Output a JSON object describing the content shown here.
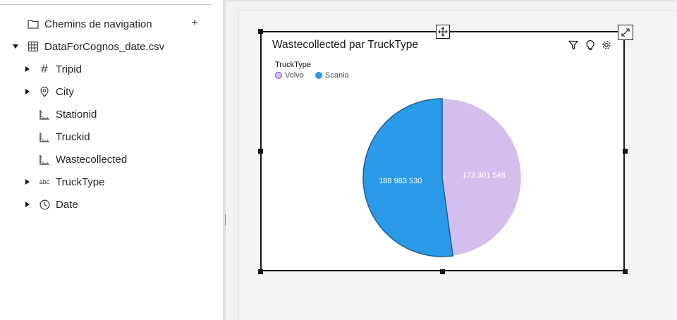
{
  "tree": {
    "paths_label": "Chemins de navigation",
    "add_symbol": "+",
    "source_name": "DataForCognos_date.csv",
    "fields": [
      {
        "label": "Tripid",
        "icon": "hash-icon",
        "expandable": true
      },
      {
        "label": "City",
        "icon": "location-pin-icon",
        "expandable": true
      },
      {
        "label": "Stationid",
        "icon": "measure-ruler-icon",
        "expandable": false
      },
      {
        "label": "Truckid",
        "icon": "measure-ruler-icon",
        "expandable": false
      },
      {
        "label": "Wastecollected",
        "icon": "measure-ruler-icon",
        "expandable": false
      },
      {
        "label": "TruckType",
        "icon": "abc-text-icon",
        "expandable": true
      },
      {
        "label": "Date",
        "icon": "clock-icon",
        "expandable": true
      }
    ],
    "abc_icon_text": "abc"
  },
  "widget": {
    "title": "Wastecollected par TruckType",
    "legend_title": "TruckType"
  },
  "chart_data": {
    "type": "pie",
    "title": "Wastecollected par TruckType",
    "legend_title": "TruckType",
    "legend_position": "top-left",
    "slices": [
      {
        "name": "Volvo",
        "value": 173301548,
        "label": "173 301 548",
        "color": "#d4bfee"
      },
      {
        "name": "Scania",
        "value": 188983530,
        "label": "188 983 530",
        "color": "#2b9ae8"
      }
    ]
  },
  "colors": {
    "volvo": "#d4bfee",
    "scania": "#2b9ae8",
    "scania_stroke": "#1f5f91"
  }
}
